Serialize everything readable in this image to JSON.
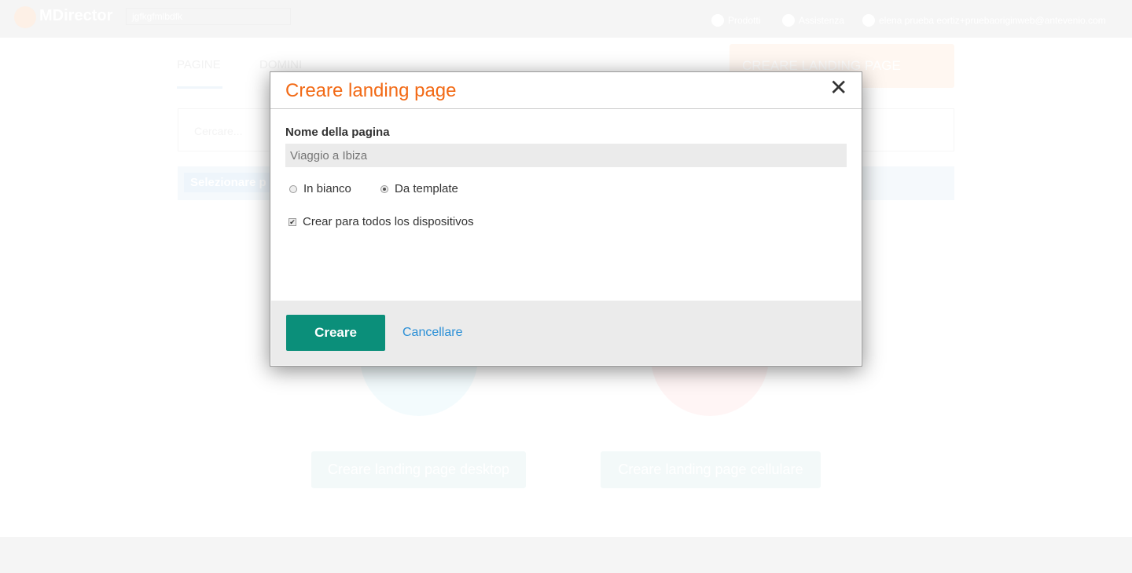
{
  "header": {
    "logo": "MDirector",
    "account_select": "jgfkgfmlbdfk",
    "nav": [
      {
        "icon": "home-icon",
        "label": "Prodotti"
      },
      {
        "icon": "help-icon",
        "label": "Assistenza"
      },
      {
        "icon": "user-icon",
        "label": "elena prueba eortiz+pruebaoriginweb@antevenio.com"
      }
    ]
  },
  "main": {
    "tabs": [
      {
        "label": "PAGINE",
        "active": true
      },
      {
        "label": "DOMINI"
      }
    ],
    "create_button": "CREARE LANDING PAGE",
    "search_placeholder": "Cercare...",
    "select_label": "Selezionare p",
    "desktop_button": "Creare landing page desktop",
    "mobile_button": "Creare landing page cellulare"
  },
  "modal": {
    "title": "Creare landing page",
    "name_label": "Nome della pagina",
    "name_placeholder": "Viaggio a Ibiza",
    "options": [
      {
        "label": "In bianco",
        "selected": false
      },
      {
        "label": "Da template",
        "selected": true
      }
    ],
    "checkbox_label": "Crear para todos los dispositivos",
    "checkbox_checked": true,
    "create": "Creare",
    "cancel": "Cancellare"
  },
  "colors": {
    "title": "#f26a16",
    "primary": "#0b8f7a",
    "link": "#2a8fd6"
  }
}
